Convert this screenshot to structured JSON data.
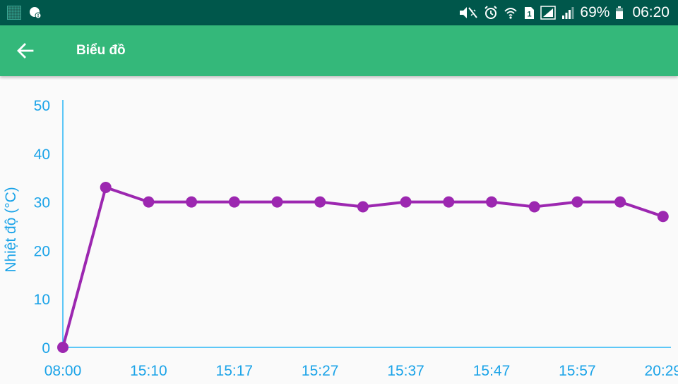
{
  "status_bar": {
    "battery_percent": "69%",
    "time": "06:20",
    "sim_slot": "1",
    "left_icons": [
      "notification-square-icon",
      "chat-bubble-icon"
    ],
    "right_icons": [
      "mute-vibrate-icon",
      "alarm-icon",
      "wifi-icon",
      "sim-icon",
      "signal-icon",
      "signal-icon",
      "battery-icon"
    ],
    "background": "#00574b"
  },
  "app_bar": {
    "title": "Biểu đồ",
    "back_icon": "arrow-left-icon",
    "background": "#34b87a"
  },
  "chart_data": {
    "type": "line",
    "ylabel": "Nhiệt độ (°C)",
    "ylim": [
      0,
      50
    ],
    "yticks": [
      0,
      10,
      20,
      30,
      40,
      50
    ],
    "xtick_labels": [
      "08:00",
      "15:10",
      "15:17",
      "15:27",
      "15:37",
      "15:47",
      "15:57",
      "20:29"
    ],
    "values": [
      0,
      33,
      30,
      30,
      30,
      30,
      30,
      29,
      30,
      30,
      30,
      29,
      30,
      30,
      27
    ],
    "line_color": "#9c27b0",
    "axis_color": "#29b6f6",
    "label_color": "#1aa3e8",
    "grid": false
  }
}
